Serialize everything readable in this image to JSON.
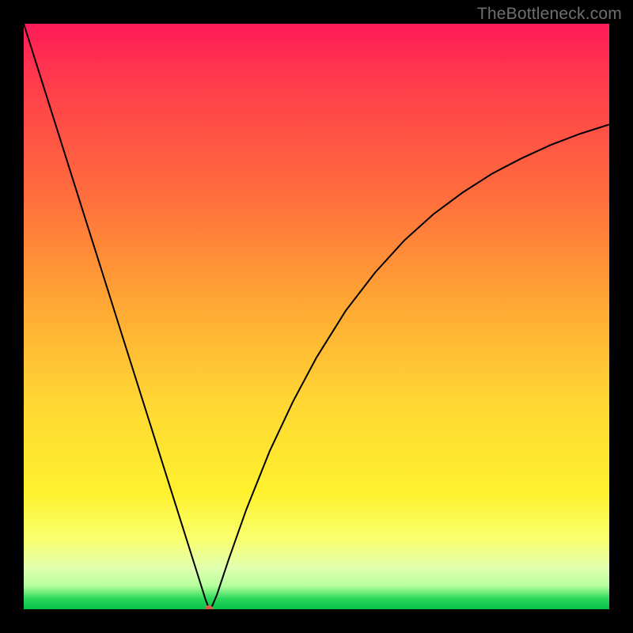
{
  "watermark": "TheBottleneck.com",
  "colors": {
    "frame": "#000000",
    "curve": "#000000",
    "marker": "#d9604c"
  },
  "chart_data": {
    "type": "line",
    "title": "",
    "xlabel": "",
    "ylabel": "",
    "xlim": [
      0,
      100
    ],
    "ylim": [
      0,
      100
    ],
    "x": [
      0,
      3,
      6,
      9,
      12,
      15,
      18,
      21,
      24,
      27,
      30,
      31,
      31.6,
      32.2,
      33,
      35,
      38,
      42,
      46,
      50,
      55,
      60,
      65,
      70,
      75,
      80,
      85,
      90,
      95,
      100
    ],
    "values": [
      100,
      90.5,
      81,
      71.5,
      62,
      52.5,
      43,
      33.5,
      24,
      14.5,
      5.0,
      1.8,
      0.2,
      0.6,
      2.5,
      8.5,
      17.0,
      27.0,
      35.5,
      43.0,
      51.0,
      57.5,
      63.0,
      67.5,
      71.2,
      74.4,
      77.0,
      79.3,
      81.2,
      82.8
    ],
    "annotations": [
      {
        "type": "marker",
        "x": 31.6,
        "y": 0.2,
        "label": "minimum"
      }
    ],
    "grid": false,
    "legend": false
  }
}
